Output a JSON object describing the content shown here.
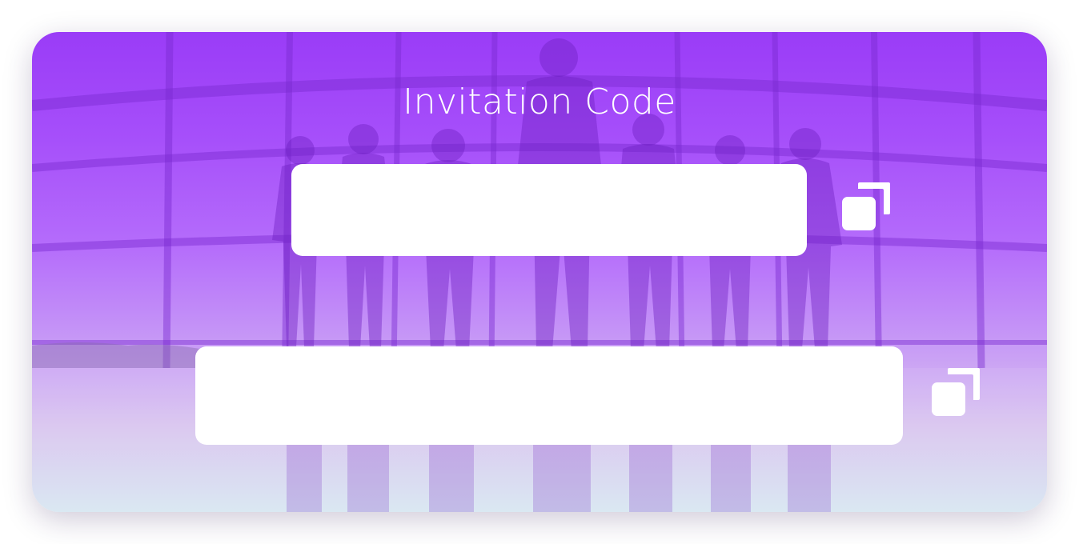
{
  "title": "Invitation Code",
  "fields": [
    {
      "value": "",
      "placeholder": ""
    },
    {
      "value": "",
      "placeholder": ""
    }
  ],
  "icons": {
    "copy": "copy-icon"
  },
  "colors": {
    "accent": "#9a3cf7",
    "field_bg": "#ffffff",
    "title": "#ffffff"
  }
}
